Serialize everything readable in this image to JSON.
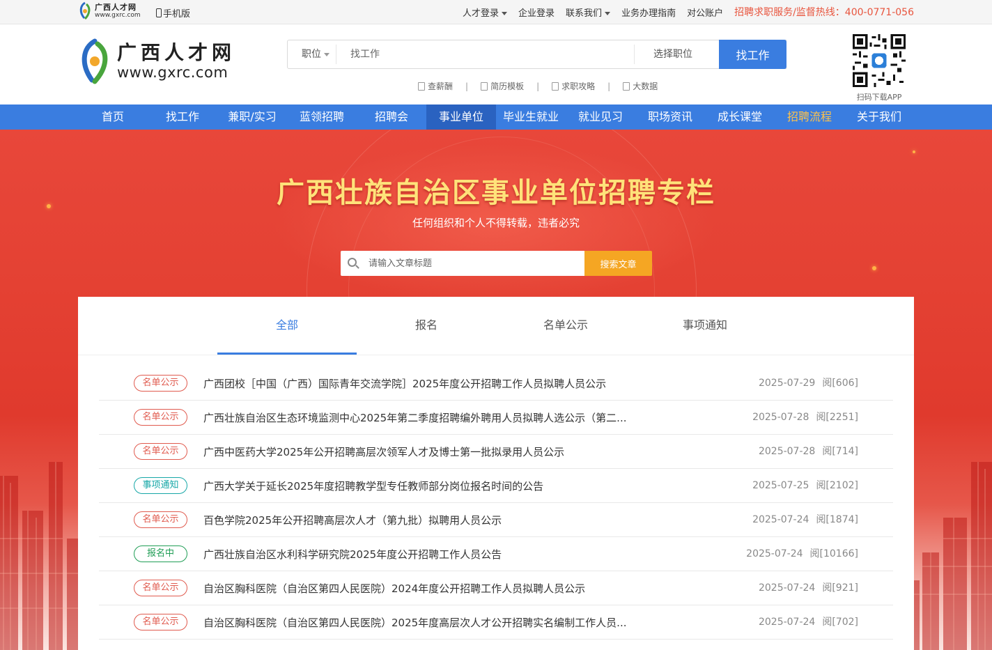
{
  "topbar": {
    "mini_logo_cn": "广西人才网",
    "mini_logo_en": "www.gxrc.com",
    "mobile": "手机版",
    "links": [
      {
        "label": "人才登录",
        "dropdown": true
      },
      {
        "label": "企业登录",
        "dropdown": false
      },
      {
        "label": "联系我们",
        "dropdown": true
      },
      {
        "label": "业务办理指南",
        "dropdown": false
      },
      {
        "label": "对公账户",
        "dropdown": false
      }
    ],
    "hotline": "招聘求职服务/监督热线：400-0771-056"
  },
  "header": {
    "logo_cn": "广西人才网",
    "logo_en": "www.gxrc.com",
    "search_type": "职位",
    "search_placeholder": "找工作",
    "select_position": "选择职位",
    "search_button": "找工作",
    "sublinks": [
      "查薪酬",
      "简历模板",
      "求职攻略",
      "大数据"
    ],
    "qr_caption": "扫码下载APP"
  },
  "nav": {
    "items": [
      "首页",
      "找工作",
      "兼职/实习",
      "蓝领招聘",
      "招聘会",
      "事业单位",
      "毕业生就业",
      "就业见习",
      "职场资讯",
      "成长课堂",
      "招聘流程",
      "关于我们"
    ],
    "active": "事业单位",
    "highlight": "招聘流程"
  },
  "banner": {
    "title": "广西壮族自治区事业单位招聘专栏",
    "subtitle": "任何组织和个人不得转载，违者必究",
    "search_placeholder": "请输入文章标题",
    "search_button": "搜索文章"
  },
  "tabs": [
    "全部",
    "报名",
    "名单公示",
    "事项通知"
  ],
  "active_tab": "全部",
  "articles": [
    {
      "tag": "名单公示",
      "tag_type": "list",
      "title": "广西团校［中国（广西）国际青年交流学院］2025年度公开招聘工作人员拟聘人员公示",
      "date": "2025-07-29",
      "views": "阅[606]"
    },
    {
      "tag": "名单公示",
      "tag_type": "list",
      "title": "广西壮族自治区生态环境监测中心2025年第二季度招聘编外聘用人员拟聘人选公示（第二...",
      "date": "2025-07-28",
      "views": "阅[2251]"
    },
    {
      "tag": "名单公示",
      "tag_type": "list",
      "title": "广西中医药大学2025年公开招聘高层次领军人才及博士第一批拟录用人员公示",
      "date": "2025-07-28",
      "views": "阅[714]"
    },
    {
      "tag": "事项通知",
      "tag_type": "notice",
      "title": "广西大学关于延长2025年度招聘教学型专任教师部分岗位报名时间的公告",
      "date": "2025-07-25",
      "views": "阅[2102]"
    },
    {
      "tag": "名单公示",
      "tag_type": "list",
      "title": "百色学院2025年公开招聘高层次人才（第九批）拟聘用人员公示",
      "date": "2025-07-24",
      "views": "阅[1874]"
    },
    {
      "tag": "报名中",
      "tag_type": "apply",
      "title": "广西壮族自治区水利科学研究院2025年度公开招聘工作人员公告",
      "date": "2025-07-24",
      "views": "阅[10166]"
    },
    {
      "tag": "名单公示",
      "tag_type": "list",
      "title": "自治区胸科医院（自治区第四人民医院）2024年度公开招聘工作人员拟聘人员公示",
      "date": "2025-07-24",
      "views": "阅[921]"
    },
    {
      "tag": "名单公示",
      "tag_type": "list",
      "title": "自治区胸科医院（自治区第四人民医院）2025年度高层次人才公开招聘实名编制工作人员...",
      "date": "2025-07-24",
      "views": "阅[702]"
    }
  ],
  "colors": {
    "primary_blue": "#3a7de0",
    "nav_active": "#2a62c0",
    "banner_red": "#e44133",
    "title_gold": "#ffe27a",
    "search_orange": "#f5a623",
    "tag_list": "#e05a4e",
    "tag_notice": "#16a7a7",
    "tag_apply": "#1f9d55",
    "hotline": "#e8553e"
  }
}
